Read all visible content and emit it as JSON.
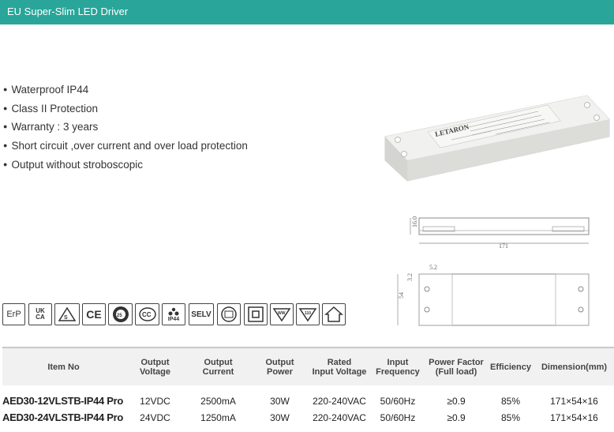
{
  "header": {
    "title": "EU Super-Slim LED Driver"
  },
  "features": [
    "Waterproof IP44",
    "Class II Protection",
    "Warranty : 3 years",
    "Short circuit ,over current and over load protection",
    "Output without stroboscopic"
  ],
  "product": {
    "brand": "LETARON",
    "colors": {
      "body": "#e8e8e6",
      "shadow": "#cfcfcc"
    }
  },
  "drawing": {
    "dim_length": "171",
    "dim_height": "16.0",
    "dim_width": "54",
    "dim_hole_a": "5.2",
    "dim_hole_b": "3.2"
  },
  "certifications": [
    {
      "label": "ErP",
      "icon": "erp-icon"
    },
    {
      "label": "UK CA",
      "icon": "ukca-icon"
    },
    {
      "label": "",
      "icon": "enec-triangle-icon"
    },
    {
      "label": "CE",
      "icon": "ce-icon"
    },
    {
      "label": "",
      "icon": "rohs-icon"
    },
    {
      "label": "",
      "icon": "ccc-icon"
    },
    {
      "label": "IP44",
      "icon": "ip44-icon"
    },
    {
      "label": "SELV",
      "icon": "selv-icon"
    },
    {
      "label": "",
      "icon": "independent-icon"
    },
    {
      "label": "",
      "icon": "class2-icon"
    },
    {
      "label": "",
      "icon": "furniture-icon"
    },
    {
      "label": "",
      "icon": "temperature-icon"
    },
    {
      "label": "",
      "icon": "indoor-use-icon"
    }
  ],
  "table": {
    "headers": {
      "item_no": "Item No",
      "output_voltage": [
        "Output",
        "Voltage"
      ],
      "output_current": [
        "Output",
        "Current"
      ],
      "output_power": [
        "Output",
        "Power"
      ],
      "rated_input": [
        "Rated",
        "Input Voltage"
      ],
      "input_freq": [
        "Input",
        "Frequency"
      ],
      "power_factor": [
        "Power Factor",
        "(Full load)"
      ],
      "efficiency": "Efficiency",
      "dimension": "Dimension(mm)"
    },
    "rows": [
      {
        "item": "AED30-12VLSTB-IP44 Pro",
        "voltage": "12VDC",
        "current": "2500mA",
        "power": "30W",
        "input": "220-240VAC",
        "freq": "50/60Hz",
        "pf": "≥0.9",
        "eff": "85%",
        "dim": "171×54×16"
      },
      {
        "item": "AED30-24VLSTB-IP44 Pro",
        "voltage": "24VDC",
        "current": "1250mA",
        "power": "30W",
        "input": "220-240VAC",
        "freq": "50/60Hz",
        "pf": "≥0.9",
        "eff": "85%",
        "dim": "171×54×16"
      }
    ]
  }
}
